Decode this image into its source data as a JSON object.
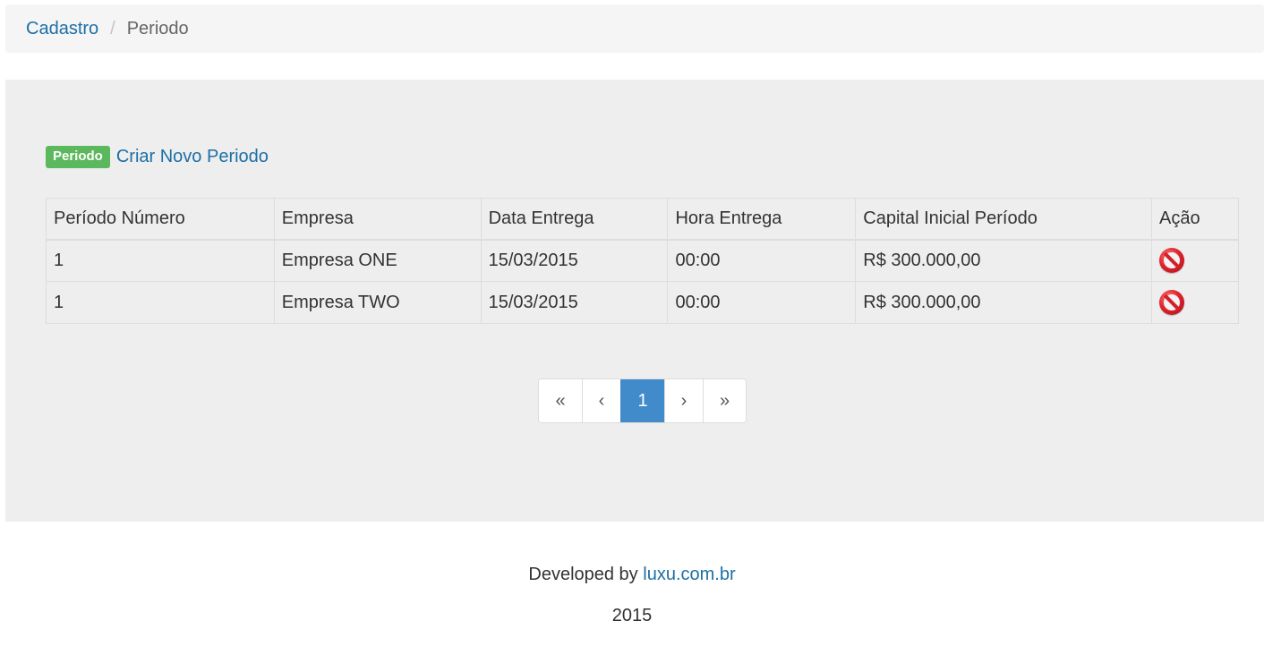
{
  "breadcrumb": {
    "root": "Cadastro",
    "separator": "/",
    "current": "Periodo"
  },
  "header": {
    "badge": "Periodo",
    "create_link": "Criar Novo Periodo"
  },
  "table": {
    "columns": [
      "Período Número",
      "Empresa",
      "Data Entrega",
      "Hora Entrega",
      "Capital Inicial Período",
      "Ação"
    ],
    "rows": [
      {
        "numero": "1",
        "empresa": "Empresa ONE",
        "data": "15/03/2015",
        "hora": "00:00",
        "capital": "R$ 300.000,00",
        "acao_icon": "delete-icon"
      },
      {
        "numero": "1",
        "empresa": "Empresa TWO",
        "data": "15/03/2015",
        "hora": "00:00",
        "capital": "R$ 300.000,00",
        "acao_icon": "delete-icon"
      }
    ]
  },
  "pagination": {
    "first": "«",
    "prev": "‹",
    "current": "1",
    "next": "›",
    "last": "»"
  },
  "footer": {
    "developed_by": "Developed by",
    "link": "luxu.com.br",
    "year": "2015"
  },
  "colors": {
    "link": "#1d6fa5",
    "badge": "#5cb85c",
    "active_page": "#428bca",
    "panel": "#eeeeee"
  }
}
